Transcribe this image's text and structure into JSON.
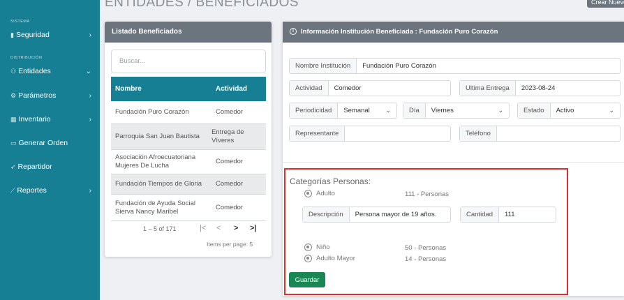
{
  "page": {
    "title": "ENTIDADES / BENEFICIADOS",
    "create_button": "Crear Nuevo"
  },
  "sidebar": {
    "sections": [
      "SISTEMA",
      "DISTRIBUCIÓN"
    ],
    "items": [
      {
        "label": "Seguridad",
        "icon": "shield-icon"
      },
      {
        "label": "Entidades",
        "icon": "users-icon"
      },
      {
        "label": "Parámetros",
        "icon": "sliders-icon"
      },
      {
        "label": "Inventario",
        "icon": "inventory-icon"
      },
      {
        "label": "Generar Orden",
        "icon": "order-icon"
      },
      {
        "label": "Repartidor",
        "icon": "delivery-icon"
      },
      {
        "label": "Reportes",
        "icon": "chart-icon"
      }
    ]
  },
  "list": {
    "title": "Listado Beneficiados",
    "search_placeholder": "Buscar...",
    "columns": [
      "Nombre",
      "Actividad"
    ],
    "rows": [
      {
        "name": "Fundación Puro Corazón",
        "activity": "Comedor"
      },
      {
        "name": "Parroquia San Juan Bautista",
        "activity": "Entrega de Víveres"
      },
      {
        "name": "Asociación Afroecuatoriana Mujeres De Lucha",
        "activity": "Comedor"
      },
      {
        "name": "Fundación Tiempos de Gloria",
        "activity": "Comedor"
      },
      {
        "name": "Fundación de Ayuda Social Sierva Nancy Maribel",
        "activity": "Comedor"
      }
    ],
    "pagination": {
      "range": "1 – 5 of 171",
      "items_per_page": "Items per page: 5"
    }
  },
  "detail": {
    "title": "Información Institución Beneficiada : Fundación Puro Corazón",
    "fields": {
      "nombre": {
        "label": "Nombre Institución",
        "value": "Fundación Puro Corazón"
      },
      "actividad": {
        "label": "Actividad",
        "value": "Comedor"
      },
      "ultima": {
        "label": "Ultima Entrega",
        "value": "2023-08-24"
      },
      "periodicidad": {
        "label": "Periodicidad",
        "value": "Semanal"
      },
      "dia": {
        "label": "Día",
        "value": "Viernes"
      },
      "estado": {
        "label": "Estado",
        "value": "Activo"
      },
      "representante": {
        "label": "Representante",
        "value": ""
      },
      "telefono": {
        "label": "Teléfono",
        "value": ""
      }
    },
    "categories": {
      "title": "Categorías Personas:",
      "items": [
        {
          "name": "Adulto",
          "count": "111 - Personas"
        },
        {
          "name": "Niño",
          "count": "50 - Personas"
        },
        {
          "name": "Adulto Mayor",
          "count": "14 - Personas"
        }
      ],
      "description": {
        "label": "Descripción",
        "value": "Persona mayor de 19 años."
      },
      "quantity": {
        "label": "Cantidad",
        "value": "111"
      }
    },
    "save_button": "Guardar"
  },
  "colors": {
    "sidebar": "#177f93",
    "header": "#6c757d",
    "accent": "#177f93",
    "save": "#198754",
    "highlight": "#d9312f"
  }
}
